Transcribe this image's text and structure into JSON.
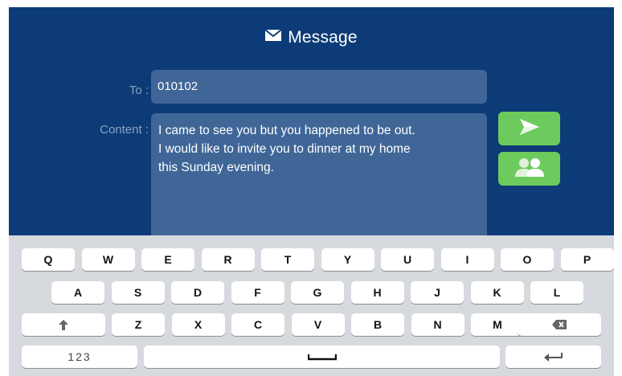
{
  "header": {
    "title": "Message",
    "icon": "envelope-icon"
  },
  "form": {
    "to_label": "To :",
    "to_value": "010102",
    "content_label": "Content :",
    "content_value": "I came to see you but you happened to be out.\nI would like to invite you to dinner at my home\nthis Sunday evening."
  },
  "buttons": {
    "send_icon": "send-icon",
    "contacts_icon": "contacts-icon",
    "color": "#6ccb5c"
  },
  "keyboard": {
    "row1": [
      "Q",
      "W",
      "E",
      "R",
      "T",
      "Y",
      "U",
      "I",
      "O",
      "P"
    ],
    "row2": [
      "A",
      "S",
      "D",
      "F",
      "G",
      "H",
      "J",
      "K",
      "L"
    ],
    "row3": [
      "Z",
      "X",
      "C",
      "V",
      "B",
      "N",
      "M"
    ],
    "numbers_label": "123",
    "shift_icon": "shift-icon",
    "backspace_icon": "backspace-icon",
    "space_icon": "space-icon",
    "enter_icon": "enter-icon"
  },
  "colors": {
    "background": "#0c3b77",
    "field": "#3f6697",
    "keyboard": "#d6d9de"
  }
}
